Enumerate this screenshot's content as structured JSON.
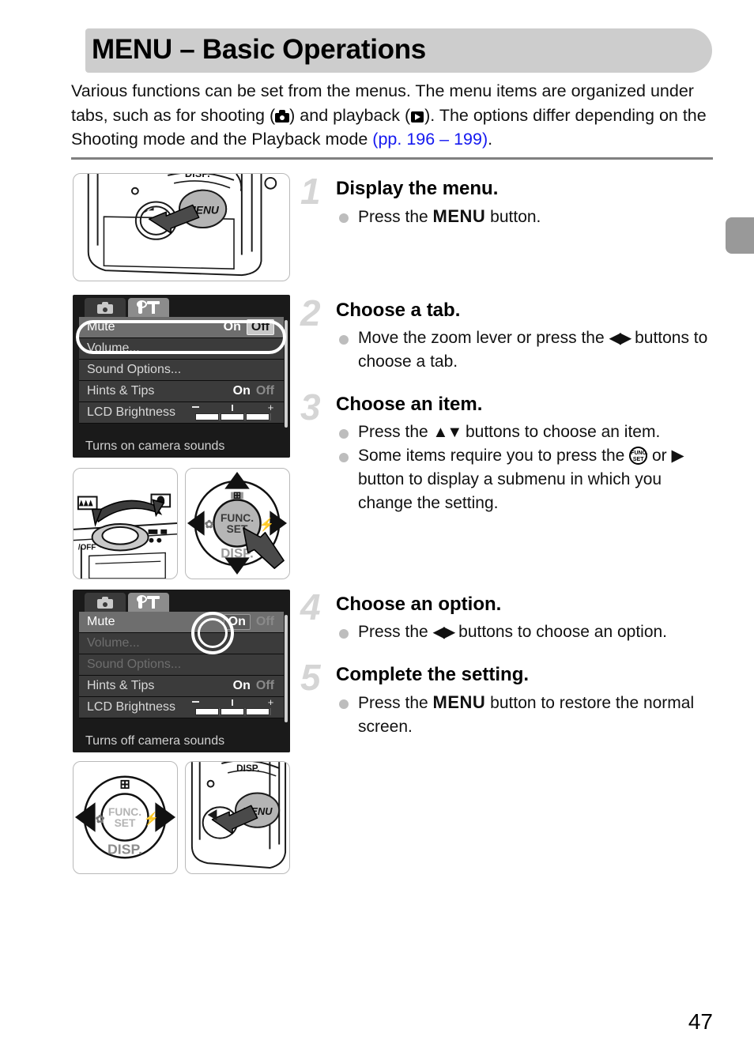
{
  "header": {
    "title": "MENU – Basic Operations"
  },
  "intro": {
    "part1": "Various functions can be set from the menus. The menu items are organized under tabs, such as for shooting (",
    "part2": ") and playback (",
    "part3": "). The options differ depending on the Shooting mode and the Playback mode ",
    "link_open": "(pp. ",
    "link_p1": "196",
    "link_dash": " – ",
    "link_p2": "199)",
    "end": ".",
    "icon_shooting": "camera-icon",
    "icon_playback": "playback-icon"
  },
  "steps": [
    {
      "num": "1",
      "title": "Display the menu.",
      "bullets": [
        {
          "pre": "Press the ",
          "key": "MENU",
          "post": " button."
        }
      ]
    },
    {
      "num": "2",
      "title": "Choose a tab.",
      "bullets": [
        {
          "pre": "Move the zoom lever or press the ",
          "key": "◀▶",
          "post": " buttons to choose a tab."
        }
      ]
    },
    {
      "num": "3",
      "title": "Choose an item.",
      "bullets": [
        {
          "pre": "Press the ",
          "key": "▲▼",
          "post": " buttons to choose an item."
        },
        {
          "pre": "Some items require you to press the ",
          "key": "FUNC. SET",
          "post": " or ▶ button to display a submenu in which you change the setting."
        }
      ]
    },
    {
      "num": "4",
      "title": "Choose an option.",
      "bullets": [
        {
          "pre": "Press the ",
          "key": "◀▶",
          "post": " buttons to choose an option."
        }
      ]
    },
    {
      "num": "5",
      "title": "Complete the setting.",
      "bullets": [
        {
          "pre": "Press the ",
          "key": "MENU",
          "post": " button to restore the normal screen."
        }
      ]
    }
  ],
  "lcd_screens": [
    {
      "id": "lcd-mute-off",
      "tabs": [
        {
          "icon": "camera-icon",
          "state": "inactive"
        },
        {
          "icon": "settings-tools-icon",
          "state": "active"
        }
      ],
      "rows": [
        {
          "label": "Mute",
          "values": [
            "On",
            "Off"
          ],
          "selected": "Off",
          "state": "highlighted"
        },
        {
          "label": "Volume...",
          "values": [],
          "selected": "",
          "state": "normal"
        },
        {
          "label": "Sound Options...",
          "values": [],
          "selected": "",
          "state": "normal"
        },
        {
          "label": "Hints & Tips",
          "values": [
            "On",
            "Off"
          ],
          "selected": "On",
          "state": "normal"
        },
        {
          "label": "LCD Brightness",
          "values": [],
          "selected": "",
          "state": "slider",
          "slider_filled": 3,
          "slider_total": 5,
          "slider_minus": "–",
          "slider_plus": "+"
        }
      ],
      "hint": "Turns on camera sounds",
      "highlight": "oval-row1"
    },
    {
      "id": "lcd-mute-on",
      "tabs": [
        {
          "icon": "camera-icon",
          "state": "inactive"
        },
        {
          "icon": "settings-tools-icon",
          "state": "active"
        }
      ],
      "rows": [
        {
          "label": "Mute",
          "values": [
            "On",
            "Off"
          ],
          "selected": "On",
          "state": "highlighted"
        },
        {
          "label": "Volume...",
          "values": [],
          "selected": "",
          "state": "dimmed"
        },
        {
          "label": "Sound Options...",
          "values": [],
          "selected": "",
          "state": "dimmed"
        },
        {
          "label": "Hints & Tips",
          "values": [
            "On",
            "Off"
          ],
          "selected": "On",
          "state": "normal"
        },
        {
          "label": "LCD Brightness",
          "values": [],
          "selected": "",
          "state": "slider",
          "slider_filled": 3,
          "slider_total": 5,
          "slider_minus": "–",
          "slider_plus": "+"
        }
      ],
      "hint": "Turns off camera sounds",
      "highlight": "circle-on-value"
    }
  ],
  "figures": [
    {
      "id": "camera-back-menu-button-1",
      "caption_labels": [
        "DISP.",
        "MENU"
      ]
    },
    {
      "id": "zoom-lever",
      "caption_labels": [
        "W",
        "T"
      ]
    },
    {
      "id": "control-pad-funcset-1",
      "caption_labels": [
        "FUNC. SET",
        "DISP."
      ]
    },
    {
      "id": "control-pad-lr",
      "caption_labels": [
        "FUNC. SET",
        "DISP."
      ]
    },
    {
      "id": "camera-back-menu-button-2",
      "caption_labels": [
        "DISP.",
        "MENU"
      ]
    }
  ],
  "page_number": "47",
  "colors": {
    "header_bg": "#cdcdcd",
    "link": "#1519f0",
    "step_number": "#d5d5d5",
    "bullet": "#bdbdbd",
    "edge_tab": "#999999",
    "rule": "#808080",
    "lcd_bg": "#1a1a1a"
  }
}
